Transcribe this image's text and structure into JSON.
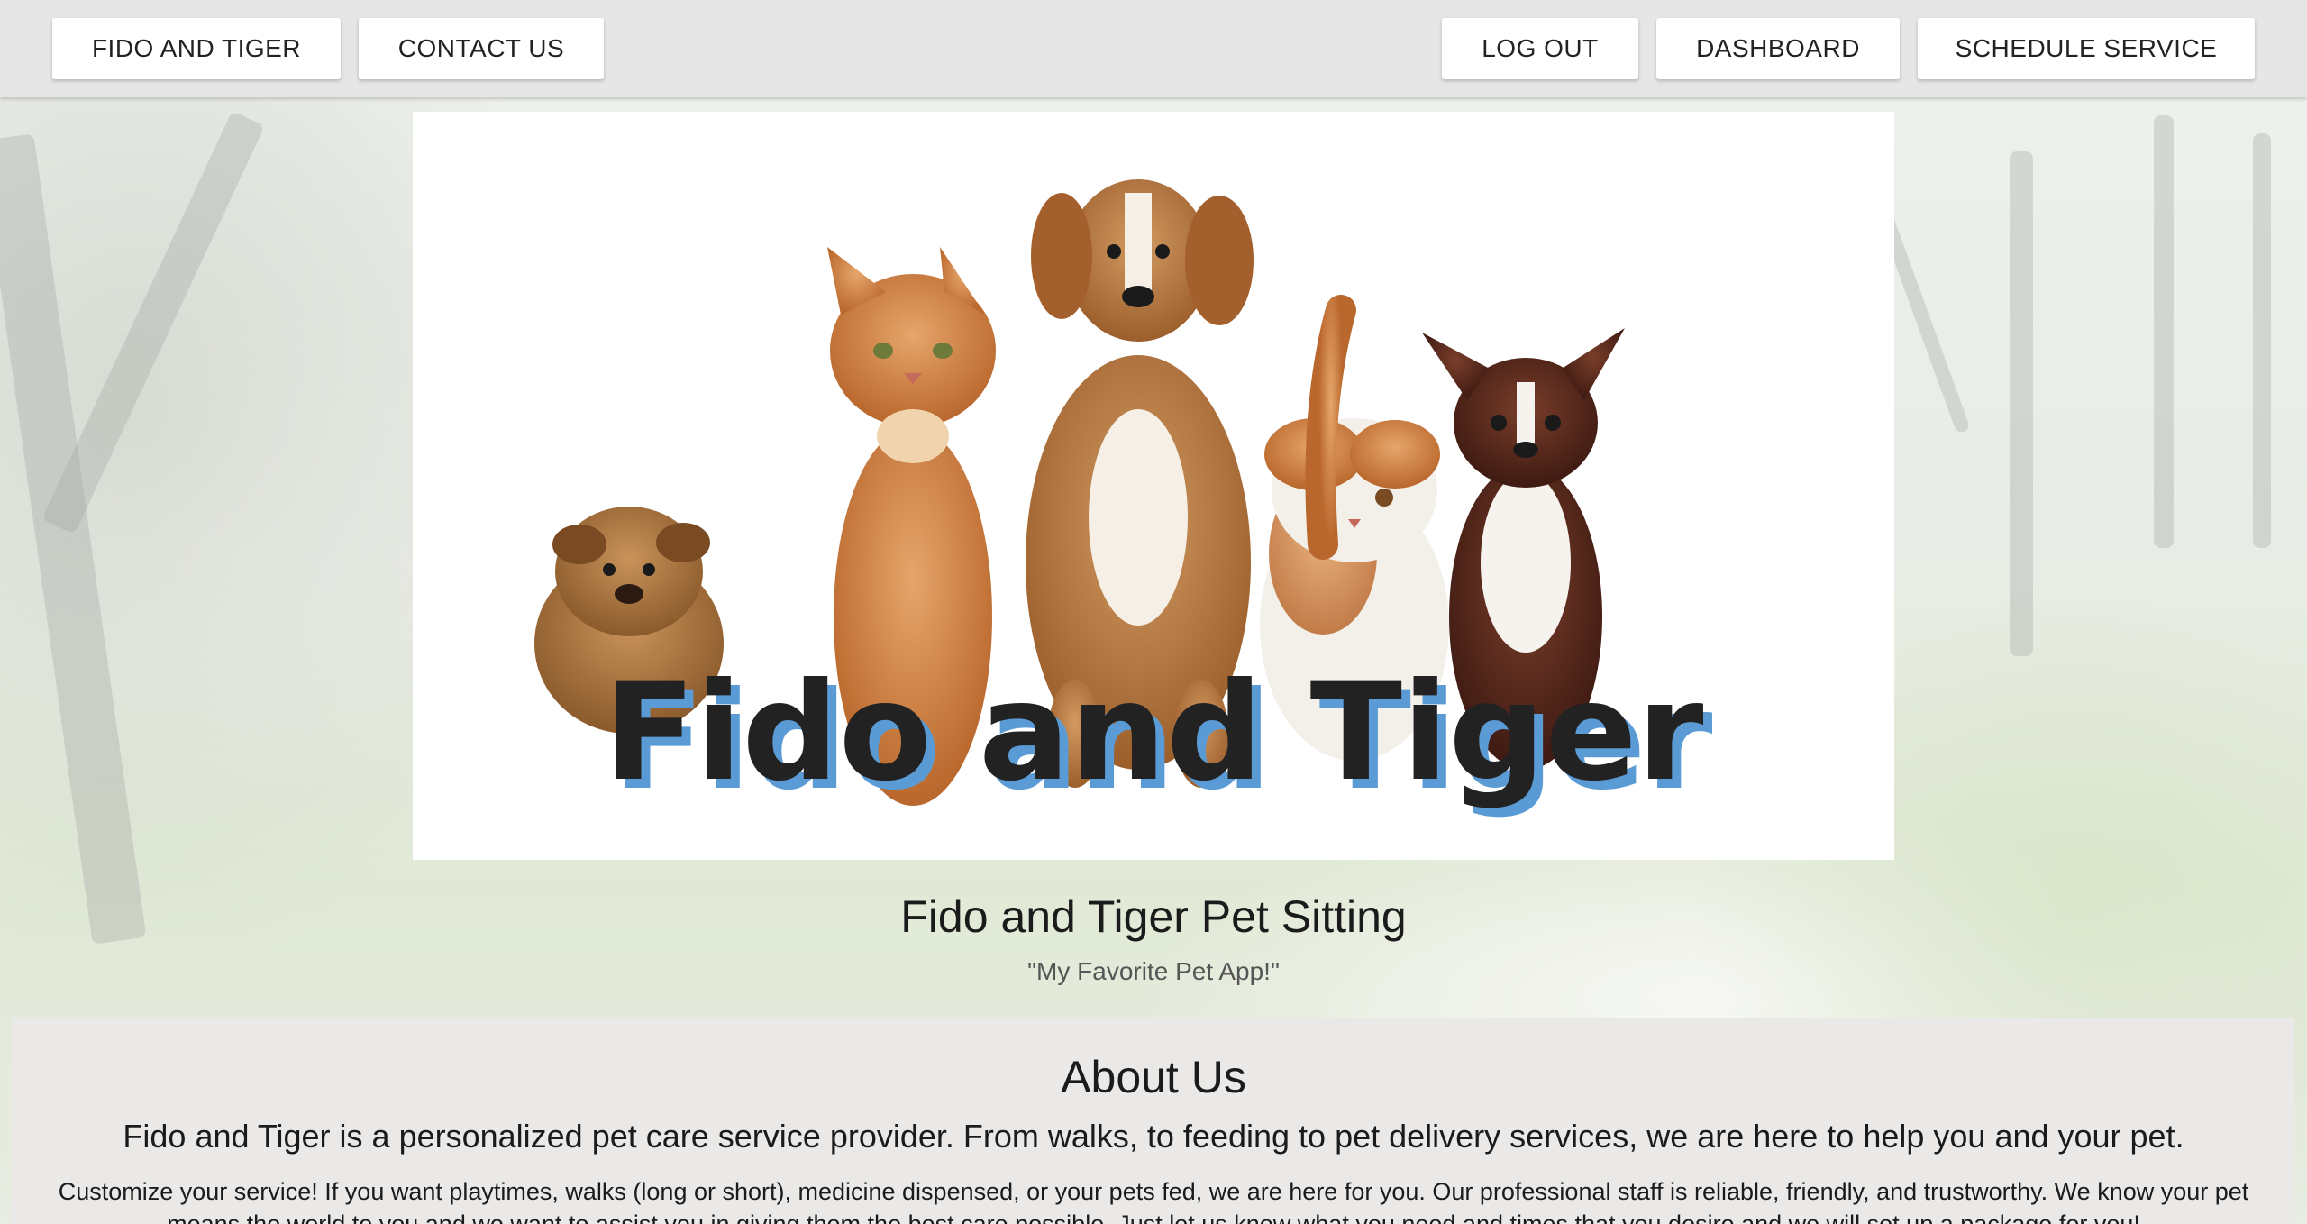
{
  "nav": {
    "home_label": "FIDO AND TIGER",
    "contact_label": "CONTACT US",
    "logout_label": "LOG OUT",
    "dashboard_label": "DASHBOARD",
    "schedule_label": "SCHEDULE SERVICE"
  },
  "hero": {
    "logo_text": "Fido and Tiger"
  },
  "site": {
    "title": "Fido and Tiger Pet Sitting",
    "tagline": "\"My Favorite Pet App!\""
  },
  "about": {
    "heading": "About Us",
    "lead": "Fido and Tiger is a personalized pet care service provider. From walks, to feeding to pet delivery services, we are here to help you and your pet.",
    "body": "Customize your service! If you want playtimes, walks (long or short), medicine dispensed, or your pets fed, we are here for you. Our professional staff is reliable, friendly, and trustworthy. We know your pet means the world to you and we want to assist you in giving them the best care possible.  Just let us know what you need and times that you desire and we will set up a package for you!"
  },
  "colors": {
    "topbar": "#e6e6e6",
    "button_bg": "#ffffff",
    "panel_bg": "#ebe9e7",
    "logo_text": "#222222",
    "logo_shadow": "#5b9bd5"
  }
}
